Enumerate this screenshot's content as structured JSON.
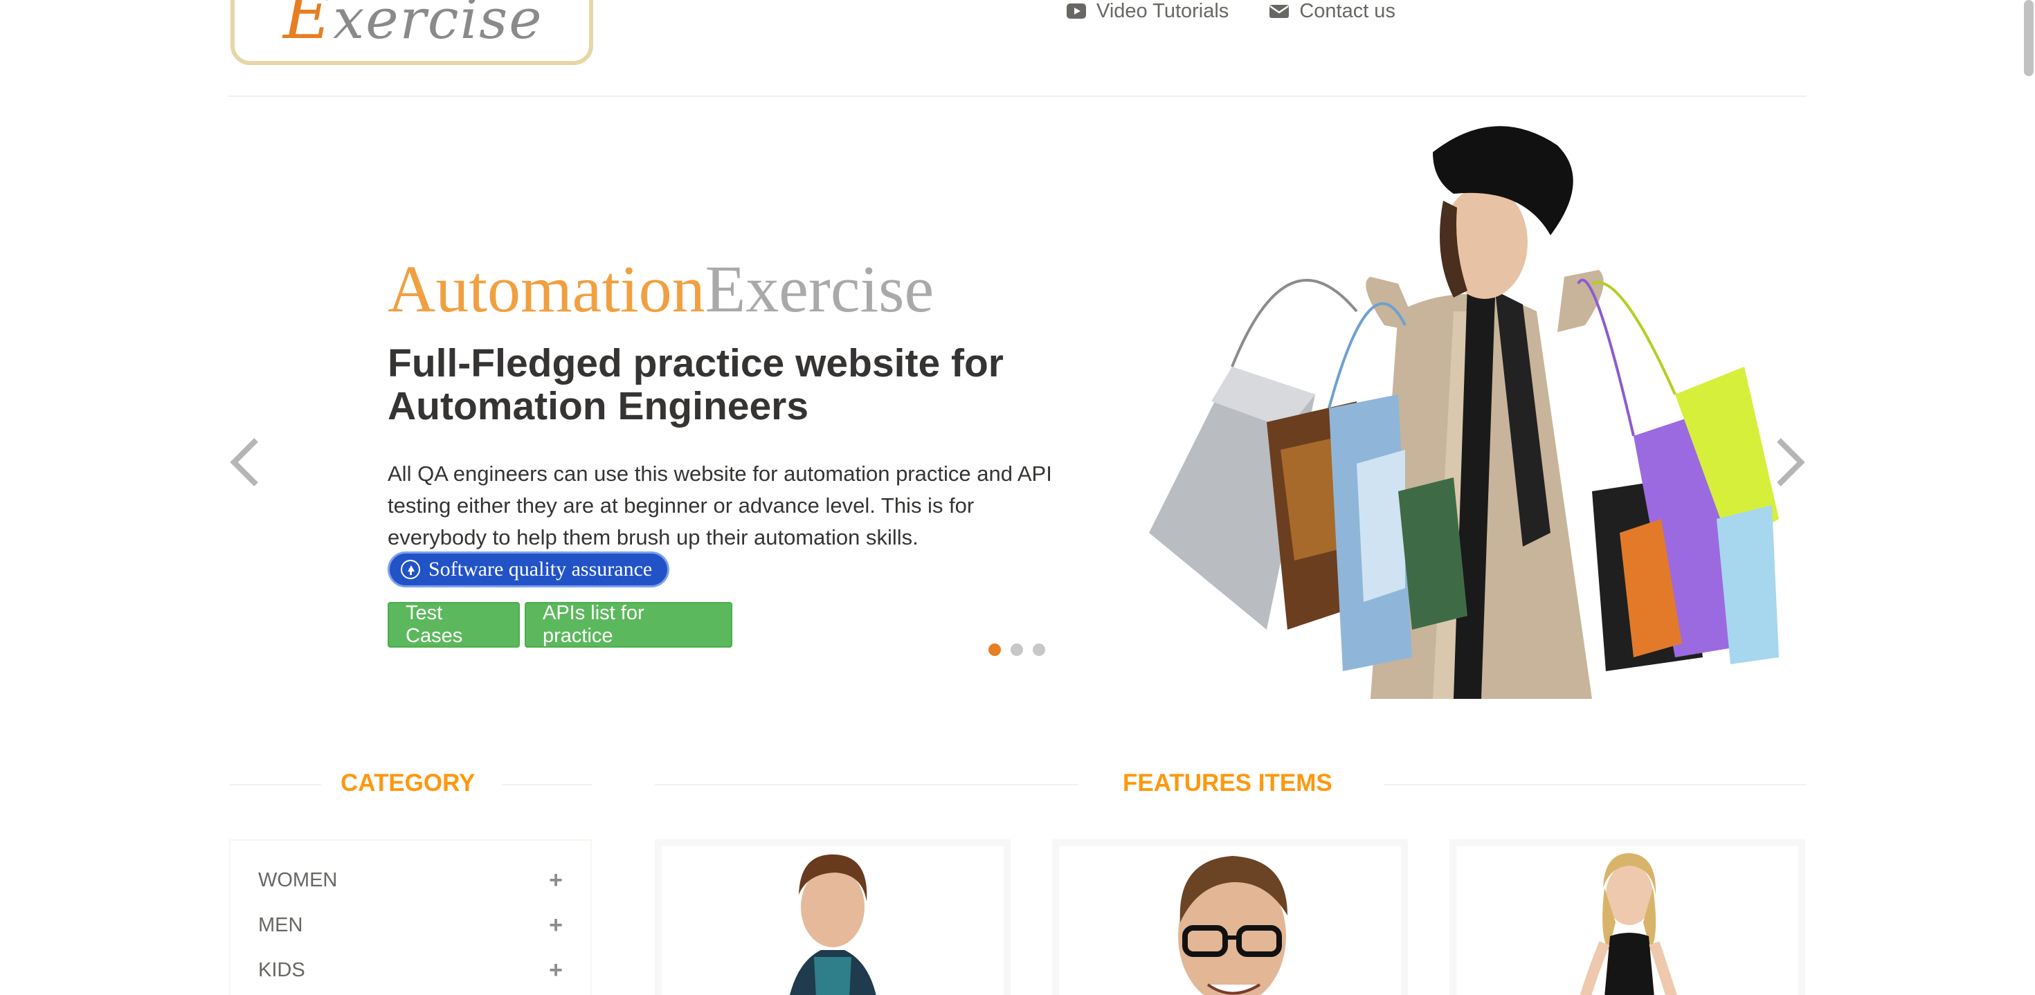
{
  "header": {
    "logo_text_e": "E",
    "logo_text_rest": "xercise",
    "nav": [
      {
        "label": "Video Tutorials",
        "icon": "youtube-icon"
      },
      {
        "label": "Contact us",
        "icon": "envelope-icon"
      }
    ]
  },
  "slider": {
    "brand_part1": "Automation",
    "brand_part2": "Exercise",
    "headline": "Full-Fledged practice website for Automation Engineers",
    "description": "All QA engineers can use this website for automation practice and API testing either they are at beginner or advance level. This is for everybody to help them brush up their automation skills.",
    "chip_label": "Software quality assurance",
    "buttons": {
      "test_cases": "Test Cases",
      "apis": "APIs list for practice"
    },
    "active_slide": 1,
    "slide_count": 3
  },
  "category": {
    "title": "CATEGORY",
    "items": [
      {
        "label": "WOMEN"
      },
      {
        "label": "MEN"
      },
      {
        "label": "KIDS"
      }
    ]
  },
  "features": {
    "title": "FEATURES ITEMS"
  },
  "colors": {
    "accent_orange": "#fe980f",
    "brand_orange": "#f0a040",
    "button_green": "#5cb85c",
    "chip_blue": "#2153c7"
  }
}
